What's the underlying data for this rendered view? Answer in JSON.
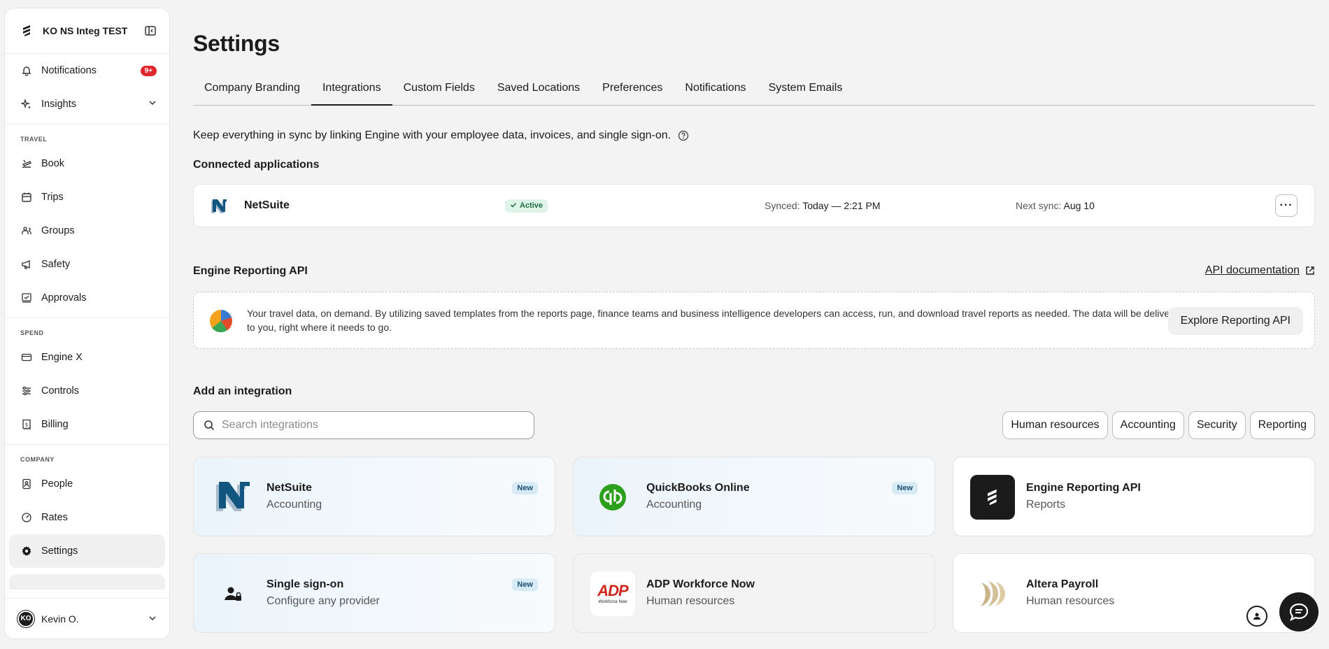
{
  "sidebar": {
    "org_name": "KO NS Integ TEST",
    "notifications_label": "Notifications",
    "notifications_badge": "9+",
    "insights_label": "Insights",
    "sections": {
      "travel": "TRAVEL",
      "spend": "SPEND",
      "company": "COMPANY"
    },
    "travel_items": [
      "Book",
      "Trips",
      "Groups",
      "Safety",
      "Approvals"
    ],
    "spend_items": [
      "Engine X",
      "Controls",
      "Billing"
    ],
    "company_items": [
      "People",
      "Rates",
      "Settings"
    ],
    "user": {
      "initials": "KO",
      "name": "Kevin O."
    }
  },
  "page": {
    "title": "Settings",
    "tabs": [
      "Company Branding",
      "Integrations",
      "Custom Fields",
      "Saved Locations",
      "Preferences",
      "Notifications",
      "System Emails"
    ],
    "active_tab": "Integrations",
    "intro": "Keep everything in sync by linking Engine with your employee data, invoices, and single sign-on."
  },
  "connected": {
    "heading": "Connected applications",
    "app_name": "NetSuite",
    "status": "Active",
    "synced_label": "Synced:",
    "synced_value": "Today — 2:21 PM",
    "next_label": "Next sync:",
    "next_value": "Aug 10",
    "more": "···"
  },
  "reporting_api": {
    "heading": "Engine Reporting API",
    "doc_link": "API documentation",
    "description": "Your travel data, on demand. By utilizing saved templates from the reports page, finance teams and business intelligence developers can access, run, and download travel reports as needed. The data will be delivered to you, right where it needs to go.",
    "button": "Explore Reporting API"
  },
  "add_integration": {
    "heading": "Add an integration",
    "search_placeholder": "Search integrations",
    "filters": [
      "Human resources",
      "Accounting",
      "Security",
      "Reporting"
    ],
    "cards": [
      {
        "title": "NetSuite",
        "subtitle": "Accounting",
        "badge": "New",
        "icon": "netsuite-logo"
      },
      {
        "title": "QuickBooks Online",
        "subtitle": "Accounting",
        "badge": "New",
        "icon": "quickbooks-logo"
      },
      {
        "title": "Engine Reporting API",
        "subtitle": "Reports",
        "badge": "",
        "icon": "engine-logo"
      },
      {
        "title": "Single sign-on",
        "subtitle": "Configure any provider",
        "badge": "New",
        "icon": "user-lock-icon"
      },
      {
        "title": "ADP Workforce Now",
        "subtitle": "Human resources",
        "badge": "",
        "icon": "adp-logo",
        "logo_text": "ADP",
        "logo_subtext": "Workforce Now"
      },
      {
        "title": "Altera Payroll",
        "subtitle": "Human resources",
        "badge": "",
        "icon": "altera-logo"
      }
    ]
  },
  "colors": {
    "accent_dark": "#1b1b1b",
    "badge_red": "#e0262b",
    "active_green": "#1e6e41",
    "new_blue": "#1d4f73",
    "quickbooks_green": "#2ca01c",
    "adp_red": "#d0271d",
    "netsuite_blue": "#125580"
  }
}
